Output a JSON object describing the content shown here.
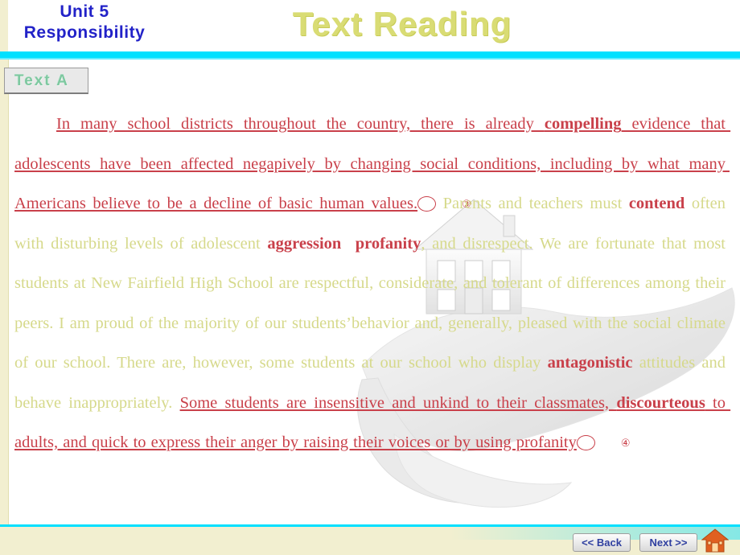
{
  "header": {
    "unit_line1": "Unit  5",
    "unit_line2": "Responsibility",
    "title": "Text Reading"
  },
  "tab": {
    "label": "Text A"
  },
  "body": {
    "segments": [
      {
        "text": "In many school districts throughout the country, there is already ",
        "style": "red-underline"
      },
      {
        "text": "compelling",
        "style": "bold-red-underline"
      },
      {
        "text": " evidence that adolescents have been affected negapively by changing social conditions, including by what many Americans believe to be a decline of basic human values.",
        "style": "red-underline"
      },
      {
        "text": "③",
        "style": "circled-number"
      },
      {
        "text": " Parents and teachers must ",
        "style": "plain"
      },
      {
        "text": "contend",
        "style": "bold-red"
      },
      {
        "text": " often with disturbing levels of adolescent ",
        "style": "plain"
      },
      {
        "text": "aggression",
        "style": "bold-red"
      },
      {
        "text": "  ",
        "style": "plain"
      },
      {
        "text": "profanity",
        "style": "bold-red"
      },
      {
        "text": ", and disrespect. We are fortunate that most students at New Fairfield High School are respectful, considerate, and tolerant of differences among their peers. I am proud of the majority of our students’behavior and, generally, pleased with the social climate of our school. There are, however, some students at our school who display ",
        "style": "plain"
      },
      {
        "text": "antagonistic",
        "style": "bold-red"
      },
      {
        "text": " attitudes and behave inappropriately. ",
        "style": "plain"
      },
      {
        "text": "Some students are insensitive and unkind to their classmates, ",
        "style": "red-underline"
      },
      {
        "text": "discourteous",
        "style": "bold-red-underline"
      },
      {
        "text": " to adults, and quick to express their anger by raising their voices or by using profanity",
        "style": "red-underline"
      },
      {
        "text": "④",
        "style": "circled-number"
      }
    ]
  },
  "footer": {
    "back_label": "<< Back",
    "next_label": "Next >>"
  },
  "colors": {
    "accent_cyan": "#00e0ff",
    "title_yellow": "#d9dc74",
    "unit_blue": "#2222c8",
    "body_yellow": "#d6d98b",
    "highlight_red": "#c9404a",
    "bar_cream": "#f2efd0"
  }
}
